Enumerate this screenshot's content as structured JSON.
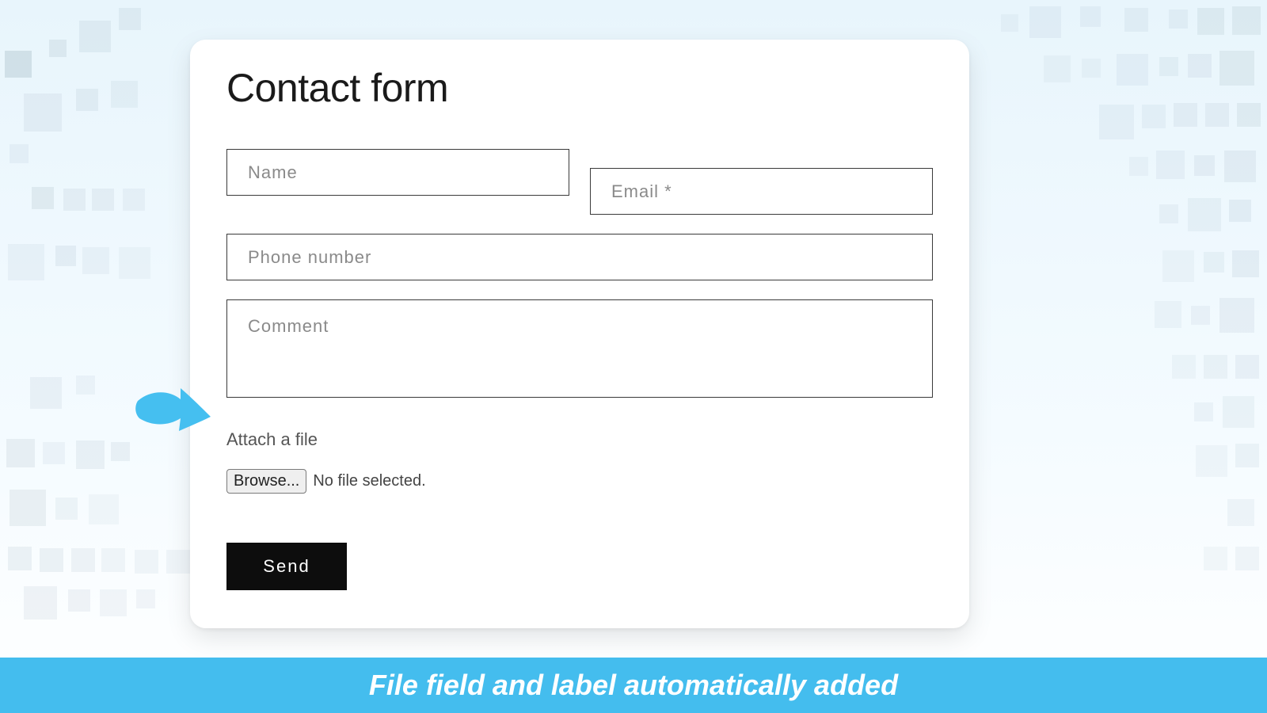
{
  "form": {
    "title": "Contact form",
    "name_placeholder": "Name",
    "email_placeholder": "Email *",
    "phone_placeholder": "Phone number",
    "comment_placeholder": "Comment",
    "attach_label": "Attach a file",
    "browse_button": "Browse...",
    "no_file_text": "No file selected.",
    "send_button": "Send"
  },
  "banner": {
    "text": "File field and label automatically added"
  },
  "colors": {
    "accent_arrow": "#45bff0",
    "banner_bg": "#44bdee",
    "send_bg": "#0d0d0d"
  }
}
